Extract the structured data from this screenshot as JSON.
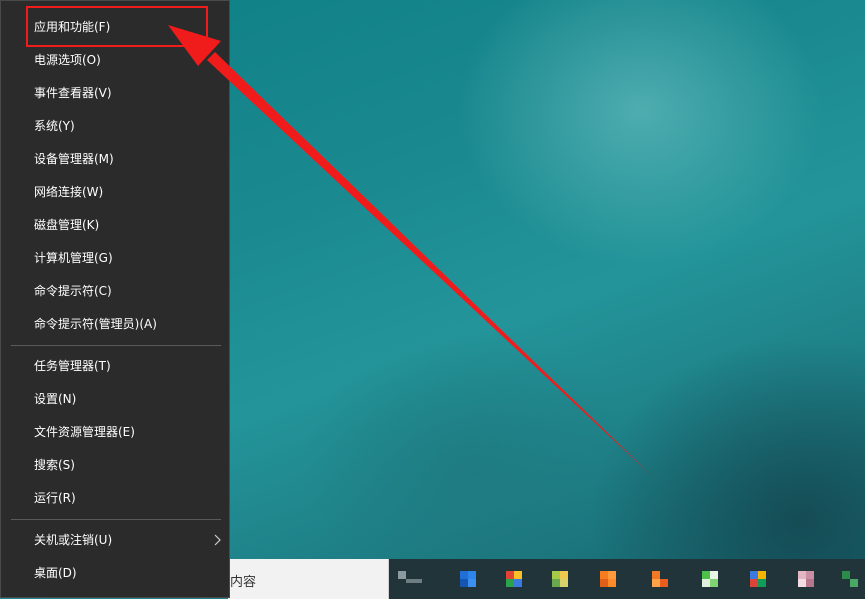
{
  "menu": {
    "items": [
      {
        "label": "应用和功能(F)"
      },
      {
        "label": "电源选项(O)"
      },
      {
        "label": "事件查看器(V)"
      },
      {
        "label": "系统(Y)"
      },
      {
        "label": "设备管理器(M)"
      },
      {
        "label": "网络连接(W)"
      },
      {
        "label": "磁盘管理(K)"
      },
      {
        "label": "计算机管理(G)"
      },
      {
        "label": "命令提示符(C)"
      },
      {
        "label": "命令提示符(管理员)(A)"
      },
      {
        "label": "任务管理器(T)"
      },
      {
        "label": "设置(N)"
      },
      {
        "label": "文件资源管理器(E)"
      },
      {
        "label": "搜索(S)"
      },
      {
        "label": "运行(R)"
      },
      {
        "label": "关机或注销(U)"
      },
      {
        "label": "桌面(D)"
      }
    ]
  },
  "taskbar": {
    "search_text": "内容"
  },
  "colors": {
    "menu_bg": "#2b2b2b",
    "menu_text": "#ffffff",
    "annotation": "#f01c1c",
    "desktop": "#1a8a90"
  }
}
